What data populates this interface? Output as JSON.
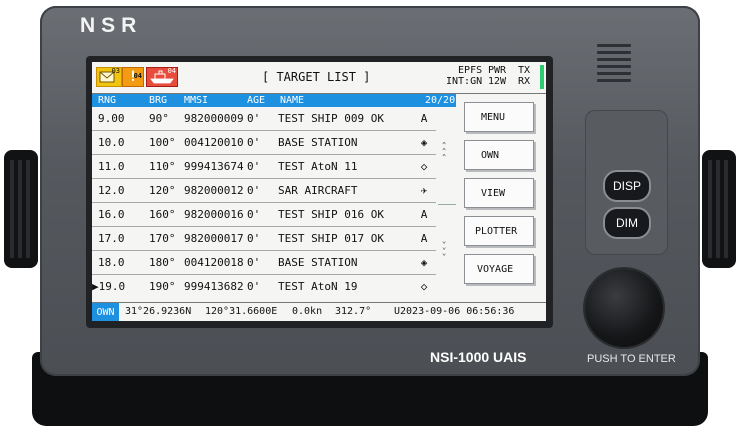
{
  "brand": "NSR",
  "model": "NSI-1000 UAIS",
  "push_label": "PUSH TO ENTER",
  "hw_buttons": {
    "disp": "DISP",
    "dim": "DIM"
  },
  "alerts": {
    "msg_count": "03",
    "warn_count": "04",
    "ship_count": "04",
    "warn_glyph": "!"
  },
  "title": "[ TARGET LIST ]",
  "status": {
    "epfs": "EPFS",
    "epfs_val": "INT:GN",
    "pwr": "PWR",
    "pwr_val": "12W",
    "tx": "TX",
    "rx": "RX"
  },
  "columns": {
    "rng": "RNG",
    "brg": "BRG",
    "mmsi": "MMSI",
    "age": "AGE",
    "name": "NAME",
    "count": "20/20"
  },
  "rows": [
    {
      "rng": "9.00",
      "brg": "90°",
      "mmsi": "982000009",
      "age": "0'",
      "name": "TEST SHIP 009 OK",
      "sym": "A"
    },
    {
      "rng": "10.0",
      "brg": "100°",
      "mmsi": "004120010",
      "age": "0'",
      "name": "BASE STATION",
      "sym": "◈"
    },
    {
      "rng": "11.0",
      "brg": "110°",
      "mmsi": "999413674",
      "age": "0'",
      "name": "TEST AtoN 11",
      "sym": "◇"
    },
    {
      "rng": "12.0",
      "brg": "120°",
      "mmsi": "982000012",
      "age": "0'",
      "name": "SAR AIRCRAFT",
      "sym": "✈"
    },
    {
      "rng": "16.0",
      "brg": "160°",
      "mmsi": "982000016",
      "age": "0'",
      "name": "TEST SHIP 016 OK",
      "sym": "A"
    },
    {
      "rng": "17.0",
      "brg": "170°",
      "mmsi": "982000017",
      "age": "0'",
      "name": "TEST SHIP 017 OK",
      "sym": "A"
    },
    {
      "rng": "18.0",
      "brg": "180°",
      "mmsi": "004120018",
      "age": "0'",
      "name": "BASE STATION",
      "sym": "◈"
    },
    {
      "rng": "▶19.0",
      "brg": "190°",
      "mmsi": "999413682",
      "age": "0'",
      "name": "TEST AtoN 19",
      "sym": "◇"
    }
  ],
  "menu": [
    "MENU",
    "OWN",
    "VIEW",
    "PLOTTER",
    "VOYAGE"
  ],
  "footer": {
    "own": "OWN",
    "lat": "31°26.9236N",
    "lon": "120°31.6600E",
    "sog": "0.0kn",
    "cog": "312.7°",
    "utc": "U2023-09-06 06:56:36"
  },
  "colors": {
    "accent": "#1e90e0",
    "tx_indicator": "#2ecc71",
    "body": "#5a5e63"
  }
}
